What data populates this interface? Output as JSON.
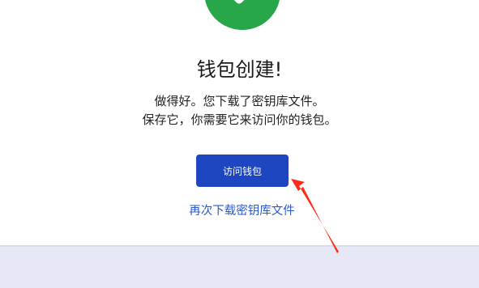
{
  "header": {
    "success_icon": "checkmark-icon"
  },
  "main": {
    "title": "钱包创建!",
    "message_line1": "做得好。您下载了密钥库文件。",
    "message_line2": "保存它，你需要它来访问你的钱包。",
    "access_button_label": "访问钱包",
    "download_again_label": "再次下载密钥库文件"
  },
  "colors": {
    "success_green": "#27a74a",
    "button_blue": "#1d46c0",
    "link_blue": "#2d5ac8",
    "footer_band": "#e6e9f5",
    "annotation_red": "#ff2a1a"
  },
  "annotation": {
    "icon": "red-arrow-icon"
  }
}
